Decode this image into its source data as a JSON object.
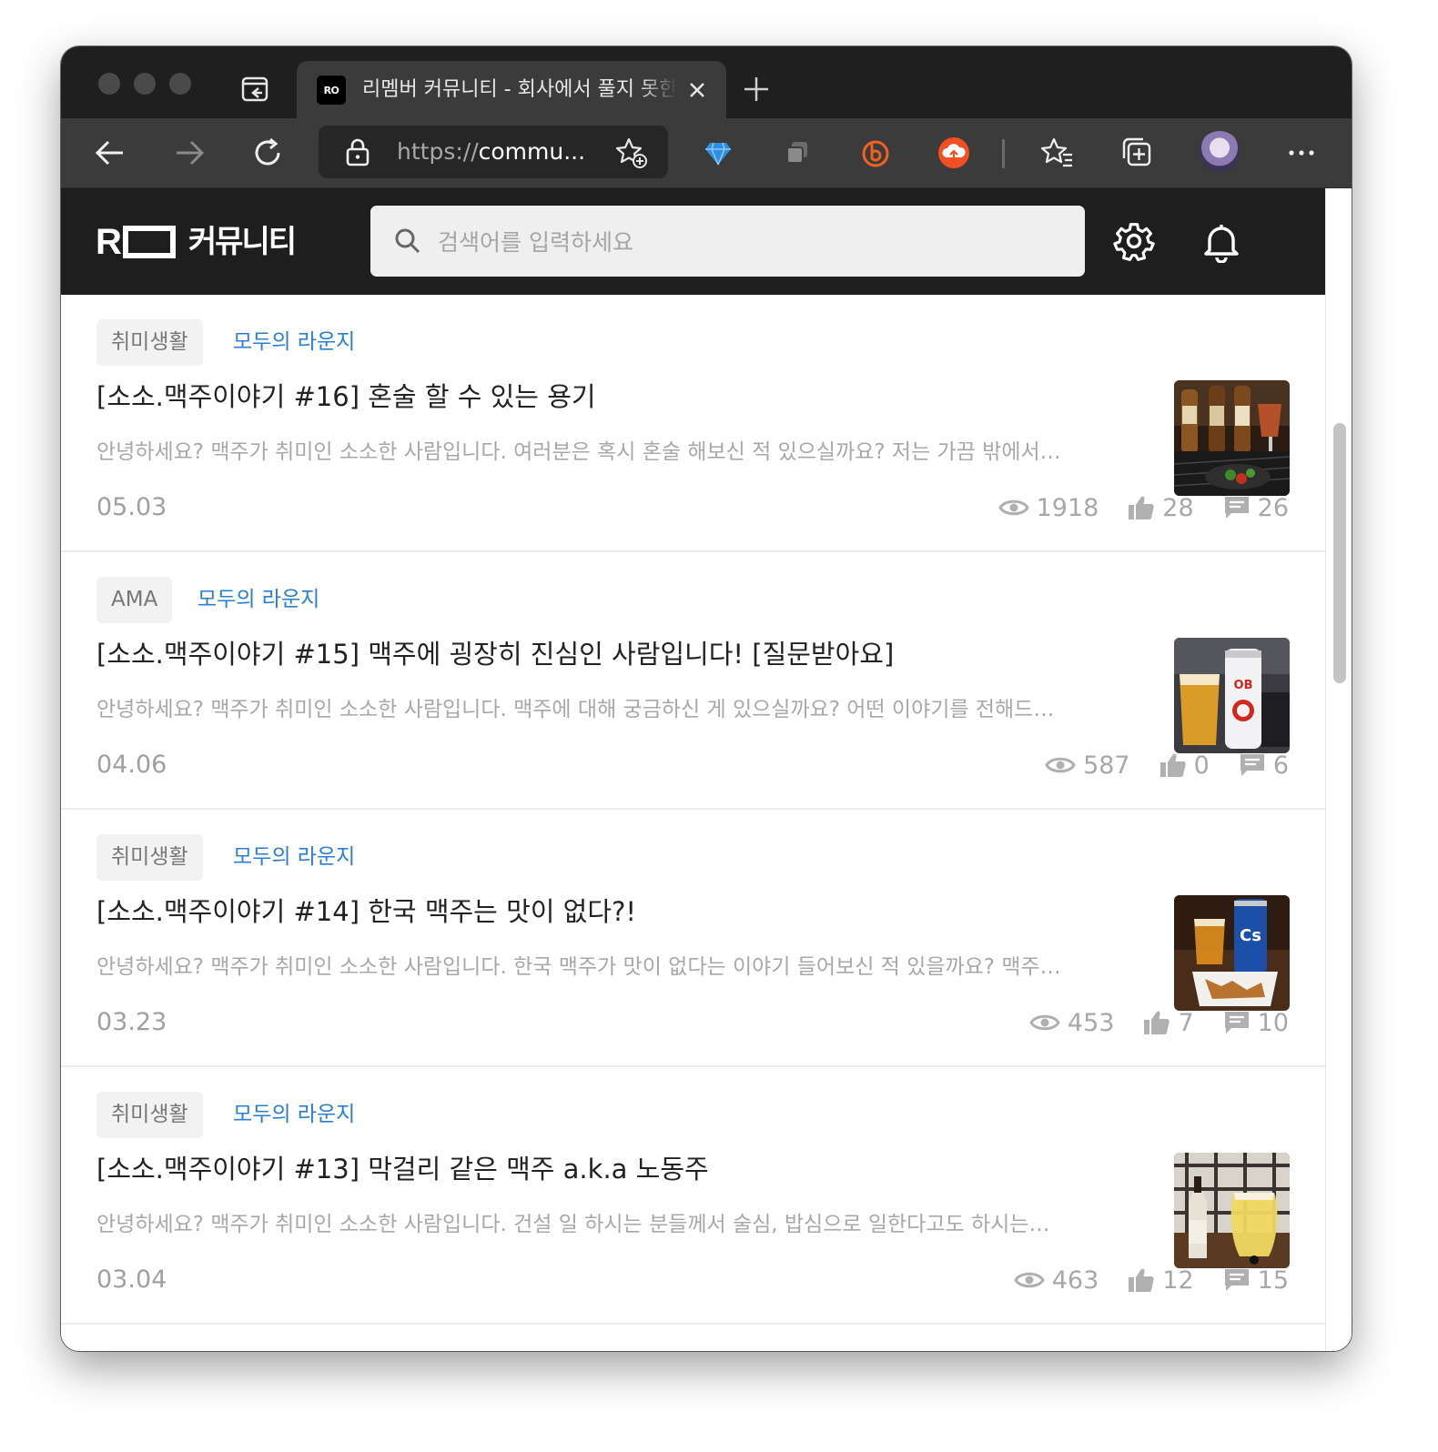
{
  "browser": {
    "tab_favicon": "RO",
    "tab_title": "리멤버 커뮤니티 - 회사에서 풀지 못한",
    "url_scheme": "https://",
    "url_rest": "commu...",
    "extension_icons": [
      "diamond-icon",
      "copy-icon",
      "bitly-icon",
      "cloud-upload-icon"
    ],
    "accent_colors": {
      "diamond": "#2f8fe6",
      "bitly": "#ee6123",
      "cloud": "#f04e23"
    }
  },
  "header": {
    "logo_mark": "R",
    "logo_text": "커뮤니티",
    "search_placeholder": "검색어를 입력하세요"
  },
  "posts": [
    {
      "category": "취미생활",
      "board": "모두의 라운지",
      "title": "[소소.맥주이야기 #16] 혼술 할 수 있는 용기",
      "excerpt": "안녕하세요? 맥주가 취미인 소소한 사람입니다. 여러분은 혹시 혼술 해보신 적 있으실까요? 저는 가끔 밖에서…",
      "date": "05.03",
      "views": "1918",
      "likes": "28",
      "comments": "26"
    },
    {
      "category": "AMA",
      "board": "모두의 라운지",
      "title": "[소소.맥주이야기 #15] 맥주에 굉장히 진심인 사람입니다! [질문받아요]",
      "excerpt": "안녕하세요? 맥주가 취미인 소소한 사람입니다. 맥주에 대해 궁금하신 게 있으실까요? 어떤 이야기를 전해드…",
      "date": "04.06",
      "views": "587",
      "likes": "0",
      "comments": "6"
    },
    {
      "category": "취미생활",
      "board": "모두의 라운지",
      "title": "[소소.맥주이야기 #14] 한국 맥주는 맛이 없다?!",
      "excerpt": "안녕하세요? 맥주가 취미인 소소한 사람입니다. 한국 맥주가 맛이 없다는 이야기 들어보신 적 있을까요? 맥주…",
      "date": "03.23",
      "views": "453",
      "likes": "7",
      "comments": "10"
    },
    {
      "category": "취미생활",
      "board": "모두의 라운지",
      "title": "[소소.맥주이야기 #13] 막걸리 같은 맥주 a.k.a 노동주",
      "excerpt": "안녕하세요? 맥주가 취미인 소소한 사람입니다. 건설 일 하시는 분들께서 술심, 밥심으로 일한다고도 하시는…",
      "date": "03.04",
      "views": "463",
      "likes": "12",
      "comments": "15"
    }
  ],
  "colors": {
    "header_bg": "#1e1e1e",
    "board_link": "#2a7fd4",
    "meta_text": "#a8a8a8"
  }
}
